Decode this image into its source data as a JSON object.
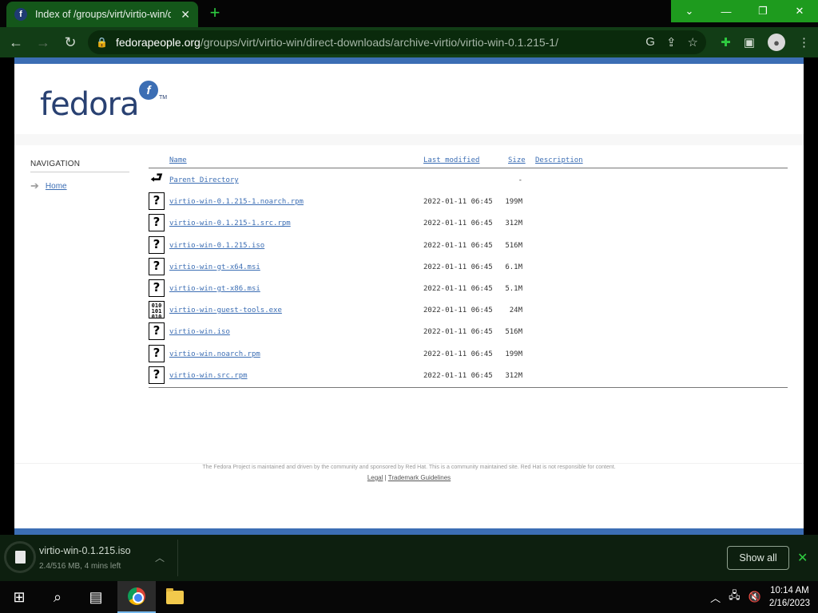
{
  "browser": {
    "tab_title": "Index of /groups/virt/virtio-win/d",
    "tab_favicon": "f",
    "url_host": "fedorapeople.org",
    "url_path": "/groups/virt/virtio-win/direct-downloads/archive-virtio/virtio-win-0.1.215-1/",
    "new_tab_glyph": "+",
    "close_glyph": "✕"
  },
  "window_controls": {
    "dropdown": "⌄",
    "minimize": "—",
    "restore": "❐",
    "close": "✕"
  },
  "site": {
    "logo_text": "fedora",
    "logo_badge": "f",
    "logo_tm": "TM"
  },
  "nav": {
    "heading": "NAVIGATION",
    "home_label": "Home"
  },
  "listing": {
    "headers": {
      "name": "Name",
      "last_modified": "Last modified",
      "size": "Size",
      "description": "Description"
    },
    "parent": {
      "name": "Parent Directory",
      "size": "-"
    },
    "files": [
      {
        "name": "virtio-win-0.1.215-1.noarch.rpm",
        "modified": "2022-01-11 06:45",
        "size": "199M",
        "icon": "unknown-file-icon"
      },
      {
        "name": "virtio-win-0.1.215-1.src.rpm",
        "modified": "2022-01-11 06:45",
        "size": "312M",
        "icon": "unknown-file-icon"
      },
      {
        "name": "virtio-win-0.1.215.iso",
        "modified": "2022-01-11 06:45",
        "size": "516M",
        "icon": "unknown-file-icon"
      },
      {
        "name": "virtio-win-gt-x64.msi",
        "modified": "2022-01-11 06:45",
        "size": "6.1M",
        "icon": "unknown-file-icon"
      },
      {
        "name": "virtio-win-gt-x86.msi",
        "modified": "2022-01-11 06:45",
        "size": "5.1M",
        "icon": "unknown-file-icon"
      },
      {
        "name": "virtio-win-guest-tools.exe",
        "modified": "2022-01-11 06:45",
        "size": "24M",
        "icon": "binary-file-icon"
      },
      {
        "name": "virtio-win.iso",
        "modified": "2022-01-11 06:45",
        "size": "516M",
        "icon": "unknown-file-icon"
      },
      {
        "name": "virtio-win.noarch.rpm",
        "modified": "2022-01-11 06:45",
        "size": "199M",
        "icon": "unknown-file-icon"
      },
      {
        "name": "virtio-win.src.rpm",
        "modified": "2022-01-11 06:45",
        "size": "312M",
        "icon": "unknown-file-icon"
      }
    ]
  },
  "footer": {
    "note": "The Fedora Project is maintained and driven by the community and sponsored by Red Hat. This is a community maintained site. Red Hat is not responsible for content.",
    "legal": "Legal",
    "separator": "|",
    "trademark": "Trademark Guidelines"
  },
  "download_shelf": {
    "file_name": "virtio-win-0.1.215.iso",
    "status": "2.4/516 MB, 4 mins left",
    "progress": 0.005,
    "show_all": "Show all"
  },
  "taskbar": {
    "time": "10:14 AM",
    "date": "2/16/2023"
  },
  "colors": {
    "fedora_blue": "#3c6eb4",
    "fedora_dark": "#294172",
    "chrome_green_tab": "#14571a",
    "window_control_green": "#1e9b1e"
  }
}
